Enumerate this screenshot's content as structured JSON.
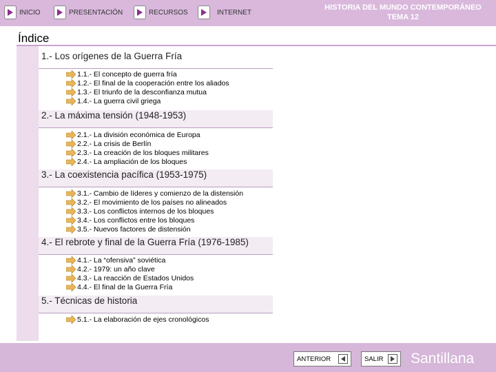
{
  "nav": {
    "inicio": "INICIO",
    "presentacion": "PRESENTACIÓN",
    "recursos": "RECURSOS",
    "internet": "INTERNET"
  },
  "header": {
    "line1": "HISTORIA DEL MUNDO CONTEMPORÁNEO",
    "line2": "TEMA 12"
  },
  "index_title": "Índice",
  "sections": [
    {
      "title": "1.- Los orígenes de la Guerra Fría",
      "items": [
        "1.1.- El concepto de guerra fría",
        "1.2.- El final de la cooperación entre los aliados",
        "1.3.- El triunfo de la desconfianza mutua",
        "1.4.- La guerra civil griega"
      ]
    },
    {
      "title": "2.- La máxima tensión (1948-1953)",
      "items": [
        "2.1.- La división económica de Europa",
        "2.2.- La crisis de Berlín",
        "2.3.- La creación de los bloques militares",
        "2.4.- La ampliación de los bloques"
      ]
    },
    {
      "title": "3.- La coexistencia pacífica (1953-1975)",
      "items": [
        "3.1.- Cambio de líderes y comienzo de la distensión",
        "3.2.- El movimiento de los países no alineados",
        "3.3.- Los conflictos internos de los bloques",
        "3.4.- Los conflictos entre los bloques",
        "3.5.- Nuevos factores de distensión"
      ]
    },
    {
      "title": "4.- El rebrote y final de la Guerra Fría (1976-1985)",
      "items": [
        "4.1.- La “ofensiva” soviética",
        "4.2.- 1979: un año clave",
        "4.3.- La reacción de Estados Unidos",
        "4.4.- El final de la Guerra Fría"
      ]
    },
    {
      "title": "5.- Técnicas de historia",
      "items": [
        "5.1.- La elaboración de ejes cronológicos"
      ]
    }
  ],
  "footer": {
    "anterior": "ANTERIOR",
    "salir": "SALIR",
    "brand": "Santillana"
  },
  "colors": {
    "bar": "#d9b8dc",
    "sidebar": "#ecdcec",
    "arrow": "#e8b65a"
  }
}
